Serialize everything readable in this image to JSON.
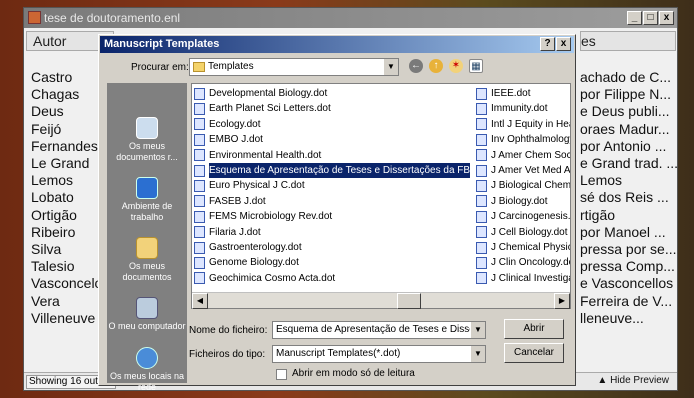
{
  "main_window": {
    "title": "tese de doutoramento.enl",
    "minimize": "_",
    "restore": "□",
    "close": "x",
    "column_author": "Autor",
    "column_right": "es",
    "authors": [
      "Castro",
      "Chagas",
      "Deus",
      "Feijó",
      "Fernandes",
      "Le Grand",
      "Lemos",
      "Lobato",
      "Ortigão",
      "Ribeiro",
      "Silva",
      "Talesio",
      "Vasconcelos",
      "Vera",
      "Villeneuve"
    ],
    "titles": [
      "achado de C...",
      "por Filippe N...",
      "e Deus publi...",
      "oraes Madur...",
      "por Antonio ...",
      "e Grand trad. ...",
      "Lemos",
      "sé dos Reis ...",
      "rtigão",
      "por Manoel ...",
      "pressa por se...",
      "pressa Comp...",
      "e Vasconcellos",
      "Ferreira de V...",
      "lleneuve..."
    ],
    "status": "Showing 16 out of 16",
    "hide_preview": "Hide Preview"
  },
  "dialog": {
    "title": "Manuscript Templates",
    "help": "?",
    "close": "x",
    "look_in_label": "Procurar em:",
    "look_in_value": "Templates",
    "places": [
      {
        "label": "Os meus documentos r..."
      },
      {
        "label": "Ambiente de trabalho"
      },
      {
        "label": "Os meus documentos"
      },
      {
        "label": "O meu computador"
      },
      {
        "label": "Os meus locais na rede"
      }
    ],
    "files_col1": [
      "Developmental Biology.dot",
      "Earth Planet Sci Letters.dot",
      "Ecology.dot",
      "EMBO J.dot",
      "Environmental Health.dot",
      "Esquema de Apresentação de Teses e Dissertações da FBAUP.dot",
      "Euro Physical J C.dot",
      "FASEB J.dot",
      "FEMS Microbiology Rev.dot",
      "Filaria J.dot",
      "Gastroenterology.dot",
      "Genome Biology.dot",
      "Geochimica Cosmo Acta.dot"
    ],
    "files_col2": [
      "IEEE.dot",
      "Immunity.dot",
      "Intl J Equity in Health",
      "Inv Ophthalmology V",
      "J Amer Chem Society",
      "J Amer Vet Med Assr",
      "J Biological Chem.dot",
      "J Biology.dot",
      "J Carcinogenesis.dot",
      "J Cell Biology.dot",
      "J Chemical Physics.d",
      "J Clin Oncology.dot",
      "J Clinical Investigatio"
    ],
    "selected_file_index": 5,
    "filename_label": "Nome do ficheiro:",
    "filename_value": "Esquema de Apresentação de Teses e Dissertaçõe",
    "filetype_label": "Ficheiros do tipo:",
    "filetype_value": "Manuscript Templates(*.dot)",
    "open_button": "Abrir",
    "cancel_button": "Cancelar",
    "readonly_label": "Abrir em modo só de leitura"
  },
  "colors": {
    "dialog_title_start": "#0a246a",
    "dialog_title_end": "#a6caf0",
    "selection": "#0a246a"
  }
}
